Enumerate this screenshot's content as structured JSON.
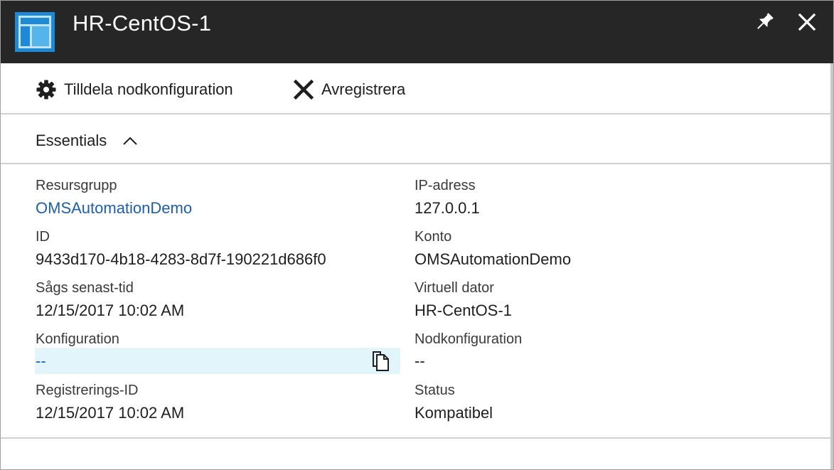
{
  "window": {
    "title": "HR-CentOS-1",
    "icon": "blade-layout-icon",
    "accent_color": "#1e8ad6",
    "titlebar_color": "#262626"
  },
  "commands": {
    "assign_label": "Tilldela nodkonfiguration",
    "unregister_label": "Avregistrera"
  },
  "essentials": {
    "label": "Essentials",
    "expanded": true,
    "left": [
      {
        "label": "Resursgrupp",
        "value": "OMSAutomationDemo",
        "is_link": true
      },
      {
        "label": "ID",
        "value": "9433d170-4b18-4283-8d7f-190221d686f0"
      },
      {
        "label": "Sågs senast-tid",
        "value": "12/15/2017 10:02 AM"
      },
      {
        "label": "Konfiguration",
        "value": "--",
        "is_link": true
      },
      {
        "label": "Registrerings-ID",
        "value": "12/15/2017 10:02 AM"
      }
    ],
    "right": [
      {
        "label": "IP-adress",
        "value": "127.0.0.1"
      },
      {
        "label": "Konto",
        "value": "OMSAutomationDemo"
      },
      {
        "label": "Virtuell dator",
        "value": "HR-CentOS-1"
      },
      {
        "label": "Nodkonfiguration",
        "value": "--"
      },
      {
        "label": "Status",
        "value": "Kompatibel"
      }
    ]
  },
  "link_color": "#1e5fa8",
  "highlight_color": "#e1f5fb"
}
